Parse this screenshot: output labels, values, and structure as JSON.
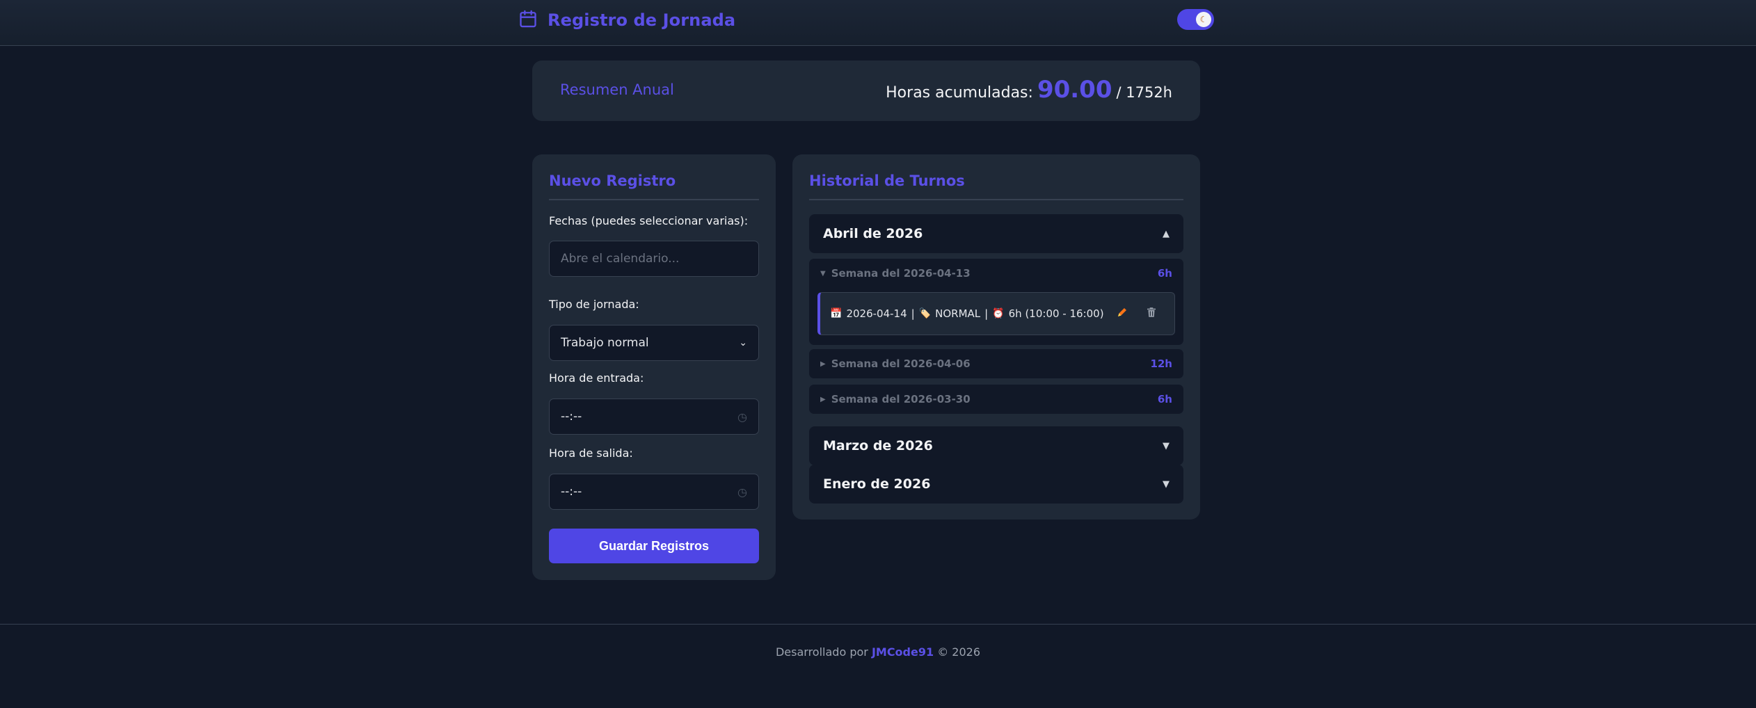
{
  "header": {
    "title": "Registro de Jornada",
    "theme_toggle_icon": "moon-icon"
  },
  "summary": {
    "title": "Resumen Anual",
    "hours_label": "Horas acumuladas:",
    "hours_value": "90.00",
    "hours_total": "/ 1752h"
  },
  "form": {
    "title": "Nuevo Registro",
    "dates_label": "Fechas (puedes seleccionar varias):",
    "dates_placeholder": "Abre el calendario...",
    "type_label": "Tipo de jornada:",
    "type_value": "Trabajo normal",
    "start_label": "Hora de entrada:",
    "start_value": "--:--",
    "end_label": "Hora de salida:",
    "end_value": "--:--",
    "save_label": "Guardar Registros"
  },
  "history": {
    "title": "Historial de Turnos",
    "months": [
      {
        "label": "Abril de 2026",
        "expanded": true,
        "weeks": [
          {
            "label": "Semana del 2026-04-13",
            "hours": "6h",
            "expanded": true,
            "entries": [
              {
                "date": "2026-04-14",
                "type": "NORMAL",
                "duration": "6h (10:00 - 16:00)"
              }
            ]
          },
          {
            "label": "Semana del 2026-04-06",
            "hours": "12h",
            "expanded": false
          },
          {
            "label": "Semana del 2026-03-30",
            "hours": "6h",
            "expanded": false
          }
        ]
      },
      {
        "label": "Marzo de 2026",
        "expanded": false
      },
      {
        "label": "Enero de 2026",
        "expanded": false
      }
    ]
  },
  "footer": {
    "prefix": "Desarrollado por",
    "author": "JMCode91",
    "suffix": "© 2026"
  },
  "colors": {
    "accent": "#4f46e5",
    "background": "#111827",
    "card": "#1f2937"
  }
}
